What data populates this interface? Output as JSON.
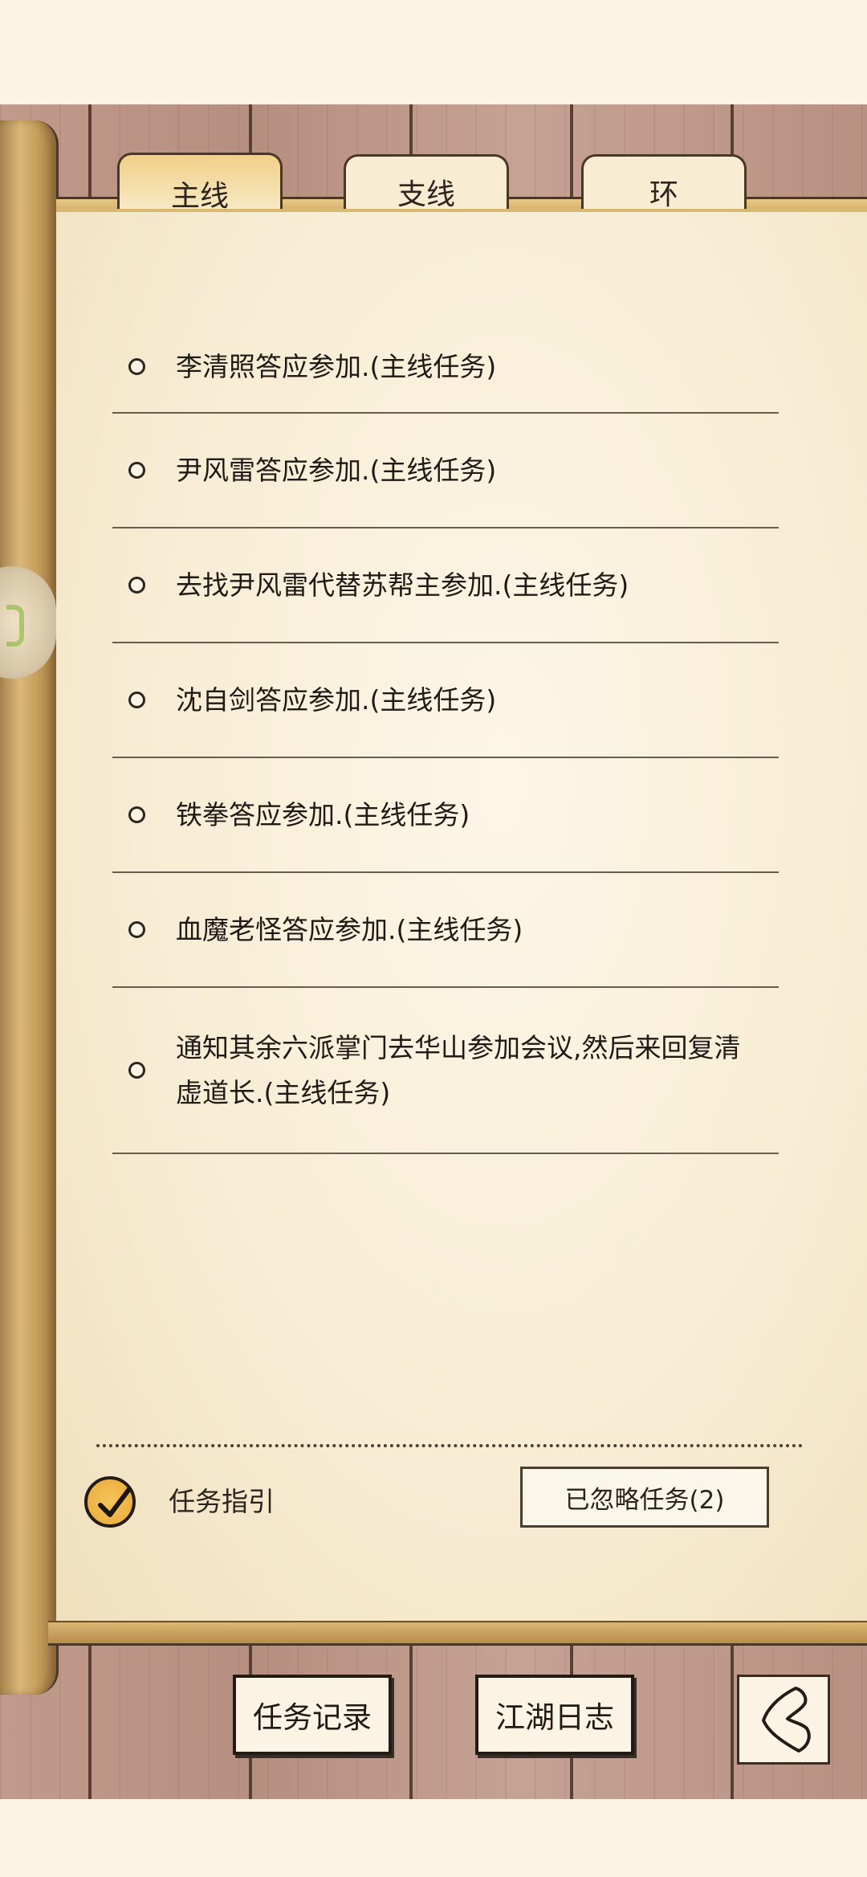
{
  "tabs": [
    {
      "label": "主线",
      "active": true
    },
    {
      "label": "支线",
      "active": false
    },
    {
      "label": "环",
      "active": false
    }
  ],
  "tasks": [
    {
      "text": "李清照答应参加.(主线任务)"
    },
    {
      "text": "尹风雷答应参加.(主线任务)"
    },
    {
      "text": "去找尹风雷代替苏帮主参加.(主线任务)"
    },
    {
      "text": "沈自剑答应参加.(主线任务)"
    },
    {
      "text": "铁拳答应参加.(主线任务)"
    },
    {
      "text": "血魔老怪答应参加.(主线任务)"
    },
    {
      "text": "通知其余六派掌门去华山参加会议,然后来回复清虚道长.(主线任务)"
    }
  ],
  "footer": {
    "guide_label": "任务指引",
    "guide_checked": true,
    "ignored_button": "已忽略任务(2)"
  },
  "bottom_nav": {
    "task_record": "任务记录",
    "jianghu_log": "江湖日志",
    "back_icon": "back-arrow-icon"
  },
  "colors": {
    "paper": "#f7ecd3",
    "wood": "#c09a8b",
    "active_tab": "#f1cf88",
    "check": "#e9a93a"
  }
}
